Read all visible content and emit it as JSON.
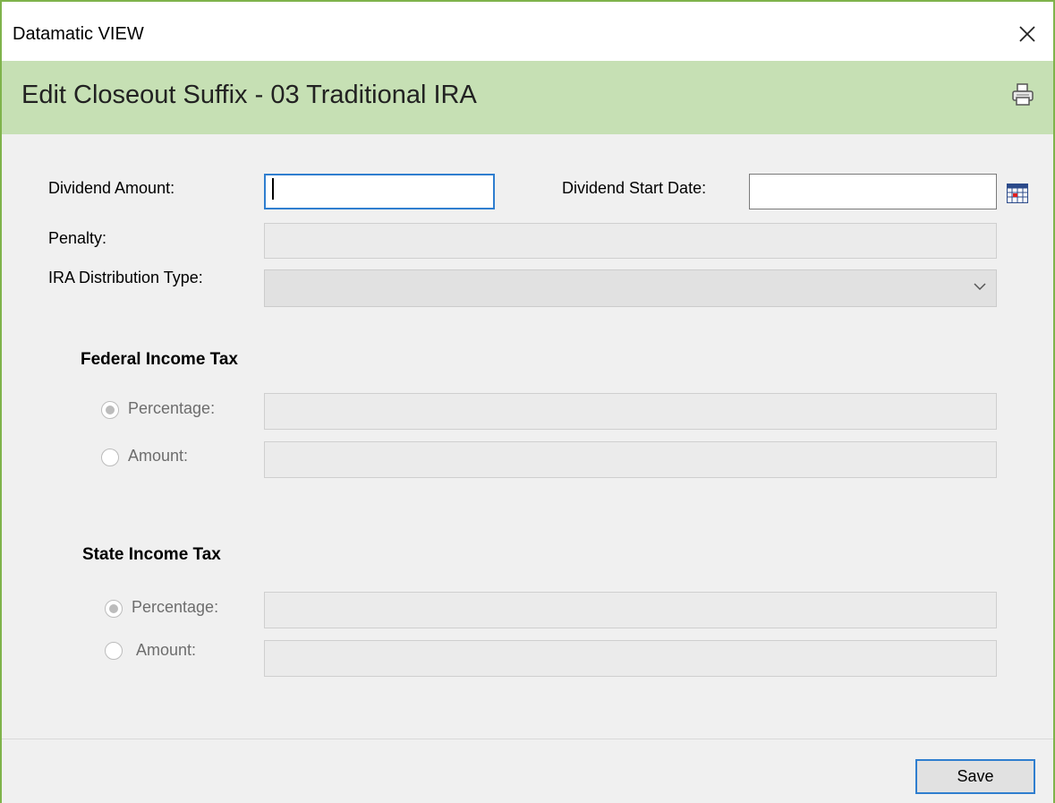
{
  "window": {
    "title": "Datamatic VIEW"
  },
  "header": {
    "title": "Edit Closeout Suffix - 03 Traditional IRA"
  },
  "icons": {
    "close": "close-icon",
    "print": "printer-icon",
    "calendar": "calendar-icon",
    "dropdown": "chevron-down-icon"
  },
  "form": {
    "dividend_amount": {
      "label": "Dividend Amount:",
      "value": ""
    },
    "dividend_start_date": {
      "label": "Dividend Start Date:",
      "value": ""
    },
    "penalty": {
      "label": "Penalty:",
      "value": ""
    },
    "ira_distribution_type": {
      "label": "IRA Distribution Type:",
      "selected": ""
    }
  },
  "federal": {
    "title": "Federal Income Tax",
    "percentage_label": "Percentage:",
    "amount_label": "Amount:",
    "selected": "percentage"
  },
  "state": {
    "title": "State Income Tax",
    "percentage_label": "Percentage:",
    "amount_label": "Amount:",
    "selected": "percentage"
  },
  "footer": {
    "save_label": "Save"
  },
  "colors": {
    "header_bg": "#c6e0b4",
    "border": "#7fb34b",
    "focus": "#2f7ecf"
  }
}
